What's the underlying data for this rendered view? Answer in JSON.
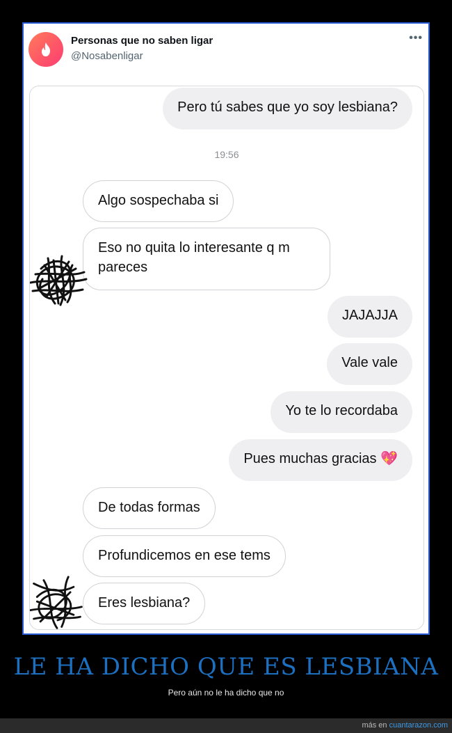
{
  "tweet": {
    "name": "Personas que no saben ligar",
    "handle": "@Nosabenligar",
    "more_icon": "•••"
  },
  "chat": {
    "timestamp": "19:56",
    "messages": [
      {
        "side": "out",
        "text": "Pero tú sabes que yo soy lesbiana?"
      },
      {
        "side": "in",
        "text": "Algo sospechaba si"
      },
      {
        "side": "in",
        "text": "Eso no quita lo interesante q m pareces"
      },
      {
        "side": "out",
        "text": "JAJAJJA"
      },
      {
        "side": "out",
        "text": "Vale vale"
      },
      {
        "side": "out",
        "text": "Yo te lo recordaba"
      },
      {
        "side": "out",
        "text": "Pues muchas gracias 💖"
      },
      {
        "side": "in",
        "text": "De todas formas"
      },
      {
        "side": "in",
        "text": "Profundicemos en ese tems"
      },
      {
        "side": "in",
        "text": "Eres lesbiana?"
      }
    ]
  },
  "caption": {
    "title": "LE HA DICHO QUE ES LESBIANA",
    "subtitle": "Pero aún no le ha dicho que no"
  },
  "footer": {
    "prefix": "más en",
    "site": "cuantarazon.com"
  },
  "colors": {
    "title_blue": "#1d6fc0",
    "frame_border": "#2a5bd7",
    "avatar_gradient": [
      "#ff7a5a",
      "#fe3c72"
    ]
  }
}
